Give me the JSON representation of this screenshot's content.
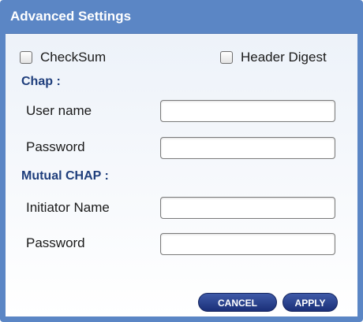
{
  "dialog": {
    "title": "Advanced Settings"
  },
  "options": {
    "checksum_label": "CheckSum",
    "checksum_checked": false,
    "header_digest_label": "Header Digest",
    "header_digest_checked": false
  },
  "chap": {
    "section_title": "Chap :",
    "username_label": "User name",
    "username_value": "",
    "password_label": "Password",
    "password_value": ""
  },
  "mutual_chap": {
    "section_title": "Mutual CHAP :",
    "initiator_label": "Initiator Name",
    "initiator_value": "",
    "password_label": "Password",
    "password_value": ""
  },
  "buttons": {
    "cancel_label": "CANCEL",
    "apply_label": "APPLY"
  },
  "colors": {
    "frame": "#5b86c5",
    "section_title": "#1f3e7c",
    "button": "#1a2f78"
  }
}
